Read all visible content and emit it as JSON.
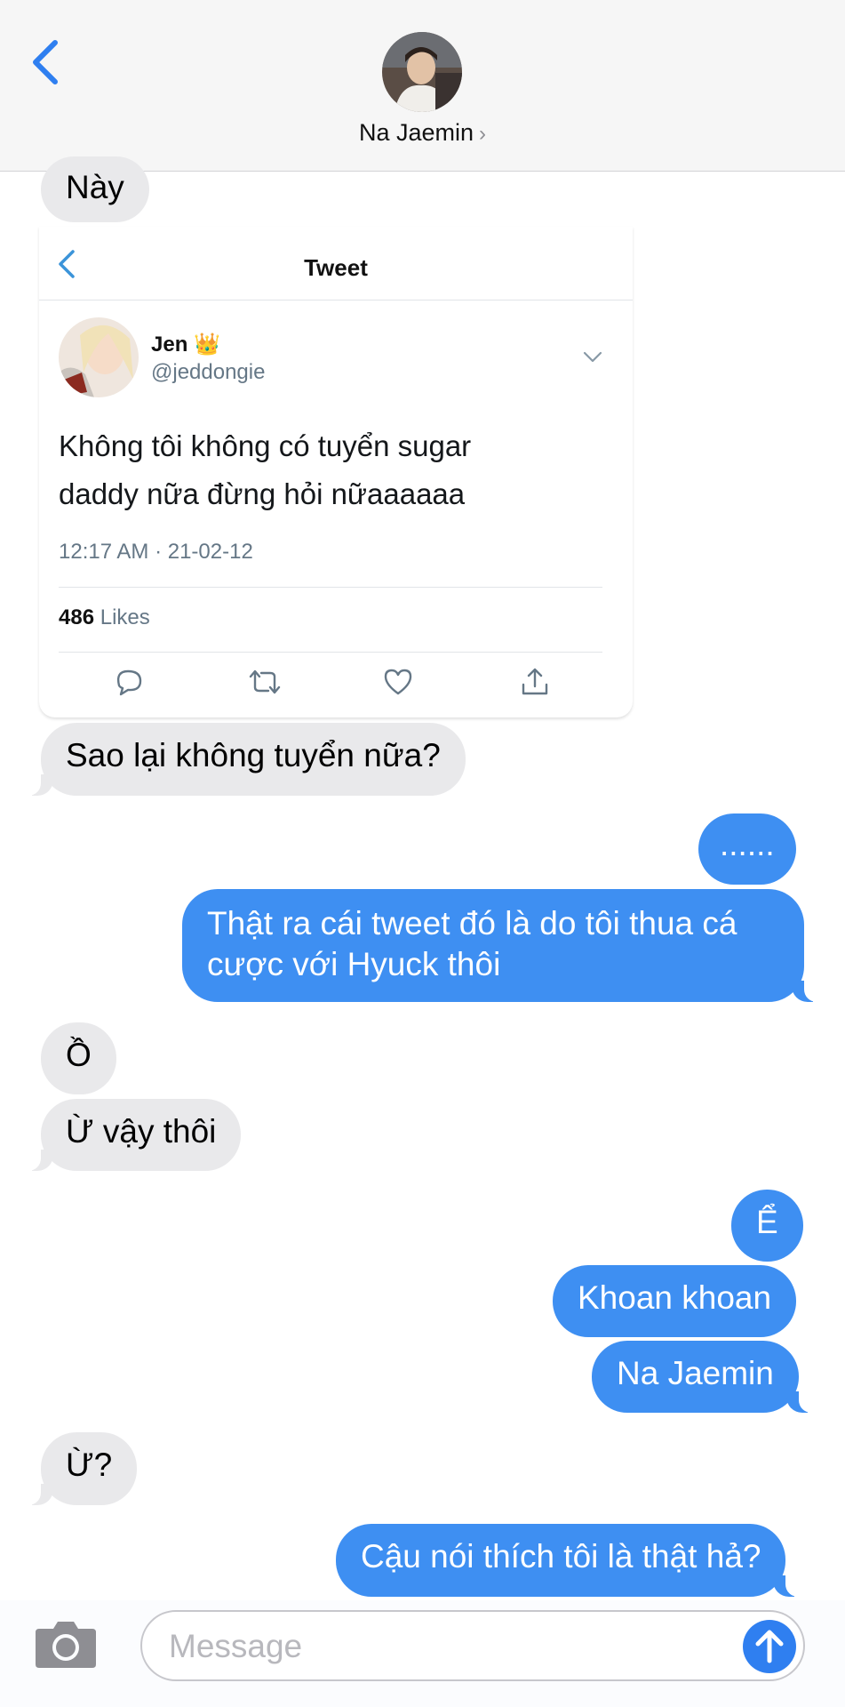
{
  "header": {
    "contact_name": "Na Jaemin",
    "chevron": "›"
  },
  "tweet": {
    "title": "Tweet",
    "author_name": "Jen",
    "author_emoji": "👑",
    "handle": "@jeddongie",
    "text": "Không tôi không có tuyển sugar daddy nữa đừng hỏi nữaaaaaa",
    "timestamp": "12:17 AM · 21-02-12",
    "likes_count": "486",
    "likes_label": "Likes",
    "actions": [
      "reply-icon",
      "retweet-icon",
      "like-icon",
      "share-icon"
    ]
  },
  "messages": [
    {
      "from": "them",
      "text": "Này"
    },
    {
      "from": "them",
      "text": "Sao lại không tuyển nữa?"
    },
    {
      "from": "me",
      "text": "......"
    },
    {
      "from": "me",
      "text": "Thật ra cái tweet đó là do tôi thua cá cược với Hyuck thôi"
    },
    {
      "from": "them",
      "text": "Ồ"
    },
    {
      "from": "them",
      "text": "Ừ vậy thôi"
    },
    {
      "from": "me",
      "text": "Ể"
    },
    {
      "from": "me",
      "text": "Khoan khoan"
    },
    {
      "from": "me",
      "text": "Na Jaemin"
    },
    {
      "from": "them",
      "text": "Ừ?"
    },
    {
      "from": "me",
      "text": "Cậu nói thích tôi là thật hả?"
    }
  ],
  "composer": {
    "placeholder": "Message"
  },
  "colors": {
    "accent": "#3e8ff2",
    "incoming_bubble": "#e9e9eb",
    "back_chevron": "#2f7ff0"
  }
}
